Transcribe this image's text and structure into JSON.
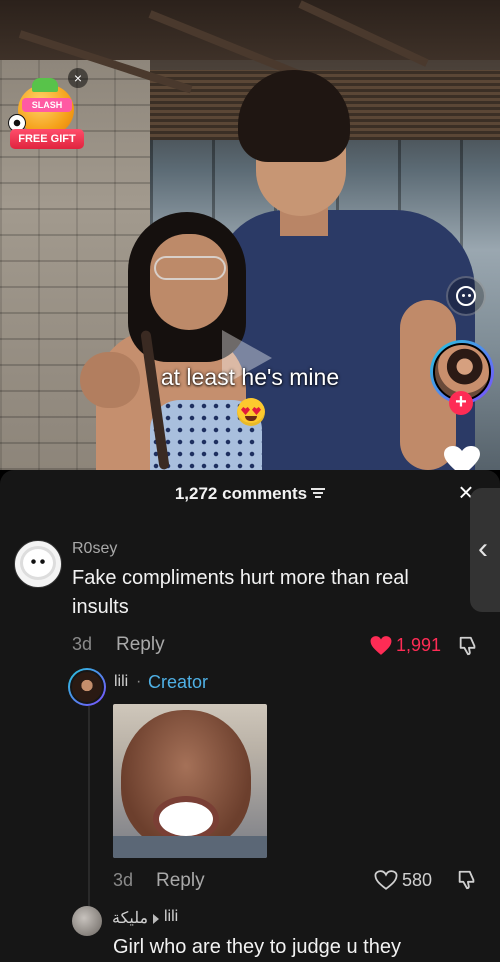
{
  "video": {
    "caption": "at least he's mine",
    "gift_badge": {
      "top_label": "SLASH",
      "label": "FREE GIFT"
    }
  },
  "comments": {
    "count_label": "1,272 comments",
    "items": [
      {
        "username": "R0sey",
        "text_line1": "Fake compliments hurt more than real",
        "text_line2": "insults",
        "age": "3d",
        "reply_label": "Reply",
        "likes": "1,991",
        "liked": true,
        "replies": [
          {
            "username": "lili",
            "separator": "·",
            "tag": "Creator",
            "has_image": true,
            "age": "3d",
            "reply_label": "Reply",
            "likes": "580"
          },
          {
            "username": "مليكة",
            "reply_to": "lili",
            "text": "Girl who are they to judge u they"
          }
        ]
      }
    ]
  },
  "colors": {
    "accent_red": "#fe2c55",
    "creator_blue": "#4fb0e5",
    "panel_bg": "#161616"
  },
  "icons": [
    "close-icon",
    "filter-icon",
    "heart-icon",
    "dislike-icon",
    "camera-icon",
    "plus-icon",
    "chevron-left-icon"
  ]
}
